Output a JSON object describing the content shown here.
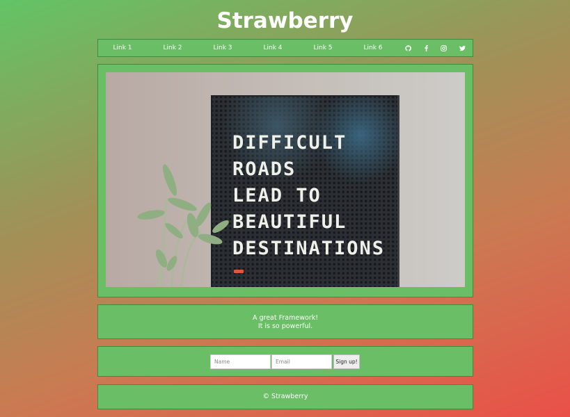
{
  "site": {
    "title": "Strawberry"
  },
  "nav": {
    "links": [
      "Link 1",
      "Link 2",
      "Link 3",
      "Link 4",
      "Link 5",
      "Link 6"
    ],
    "icons": [
      "github-icon",
      "facebook-icon",
      "instagram-icon",
      "twitter-icon"
    ]
  },
  "hero": {
    "image_alt": "Letter board with plant",
    "board_lines": [
      "DIFFICULT",
      "ROADS",
      "LEAD TO",
      "BEAUTIFUL",
      "DESTINATIONS"
    ]
  },
  "tagline": {
    "line1": "A great Framework!",
    "line2": "It is so powerful."
  },
  "signup": {
    "name_placeholder": "Name",
    "email_placeholder": "Email",
    "button_label": "Sign up!"
  },
  "footer": {
    "text": "© Strawberry"
  },
  "colors": {
    "panel": "#69be66",
    "panel_border": "#3f8b3f",
    "gradient_start": "#62c466",
    "gradient_end": "#ea5048"
  }
}
